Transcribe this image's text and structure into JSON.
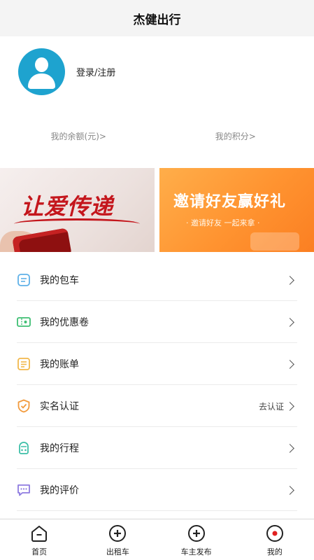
{
  "header": {
    "title": "杰健出行"
  },
  "profile": {
    "login_label": "登录/注册"
  },
  "stats": {
    "balance": "我的余额(元)>",
    "points": "我的积分>"
  },
  "banners": {
    "left": {
      "text": "让爱传递"
    },
    "right": {
      "title": "邀请好友赢好礼",
      "subtitle": "· 邀请好友 一起来拿 ·"
    }
  },
  "menu": [
    {
      "label": "我的包车",
      "icon": "charter-icon",
      "color": "#5fb1e8",
      "extra": ""
    },
    {
      "label": "我的优惠卷",
      "icon": "coupon-icon",
      "color": "#3ebf73",
      "extra": ""
    },
    {
      "label": "我的账单",
      "icon": "bill-icon",
      "color": "#f2b84b",
      "extra": ""
    },
    {
      "label": "实名认证",
      "icon": "shield-icon",
      "color": "#f29a3c",
      "extra": "去认证"
    },
    {
      "label": "我的行程",
      "icon": "trip-icon",
      "color": "#3dbfa8",
      "extra": ""
    },
    {
      "label": "我的评价",
      "icon": "comment-icon",
      "color": "#8e7be0",
      "extra": ""
    }
  ],
  "tabs": [
    {
      "label": "首页",
      "icon": "home-icon"
    },
    {
      "label": "出租车",
      "icon": "taxi-icon"
    },
    {
      "label": "车主发布",
      "icon": "publish-icon"
    },
    {
      "label": "我的",
      "icon": "me-icon",
      "active_color": "#e02020"
    }
  ]
}
